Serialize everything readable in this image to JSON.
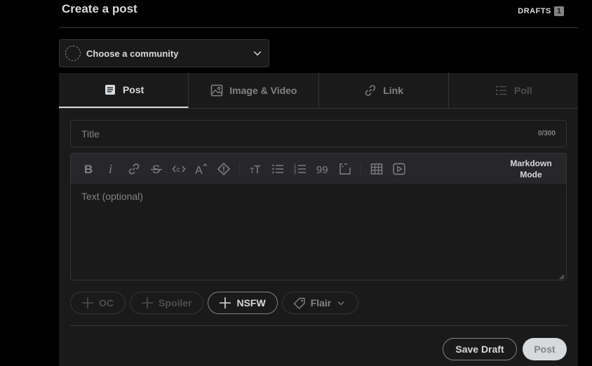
{
  "header": {
    "title": "Create a post",
    "drafts_label": "DRAFTS",
    "drafts_count": "1"
  },
  "community": {
    "label": "Choose a community",
    "icon": "chevron-down-icon"
  },
  "tabs": [
    {
      "label": "Post",
      "icon": "post-doc-icon",
      "state": "active"
    },
    {
      "label": "Image & Video",
      "icon": "image-icon",
      "state": "normal"
    },
    {
      "label": "Link",
      "icon": "link-icon",
      "state": "normal"
    },
    {
      "label": "Poll",
      "icon": "poll-icon",
      "state": "disabled"
    }
  ],
  "title_field": {
    "placeholder": "Title",
    "counter": "0/300"
  },
  "toolbar": {
    "icons": [
      "bold-icon",
      "italic-icon",
      "link-icon",
      "strikethrough-icon",
      "inline-code-icon",
      "superscript-icon",
      "spoiler-icon",
      "heading-icon",
      "bulleted-list-icon",
      "numbered-list-icon",
      "quote-block-icon",
      "code-block-icon",
      "table-icon",
      "video-icon"
    ],
    "markdown_mode_line1": "Markdown",
    "markdown_mode_line2": "Mode"
  },
  "body_field": {
    "placeholder": "Text (optional)"
  },
  "tags": [
    {
      "label": "OC",
      "state": "disabled"
    },
    {
      "label": "Spoiler",
      "state": "disabled"
    },
    {
      "label": "NSFW",
      "state": "enabled"
    },
    {
      "label": "Flair",
      "state": "mid"
    }
  ],
  "actions": {
    "save_draft": "Save Draft",
    "post": "Post"
  },
  "colors": {
    "background": "#000000",
    "card": "#1a1a1b",
    "border": "#343536",
    "text": "#d7dadc",
    "muted": "#818384"
  }
}
